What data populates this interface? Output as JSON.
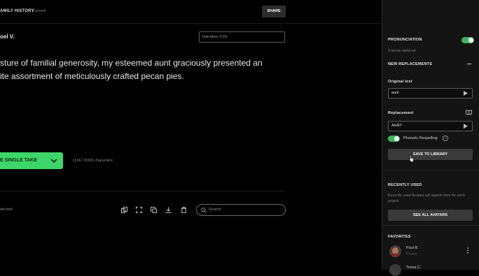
{
  "header": {
    "project_title": "AMILY HISTORY",
    "status": "Current",
    "share_label": "SHARE"
  },
  "editor": {
    "voice_name": "oel V.",
    "narration_field_value": "Narration (US)",
    "script_lines": [
      "sture of familial generosity, my esteemed aunt graciously presented an",
      "ite assortment of meticulously crafted pecan pies."
    ],
    "generate_label": "E SINGLE TAKE",
    "char_count": "(134 / 3000) characters"
  },
  "toolbar": {
    "selected_text": "elected",
    "tool_icons": [
      "copy-icon",
      "expand-icon",
      "duplicate-icon",
      "download-icon",
      "trash-icon"
    ],
    "search_placeholder": "Search"
  },
  "panel": {
    "pronunciation": {
      "title": "PRONUNCIATION",
      "enabled": true,
      "replaced_count": "0 words replaced"
    },
    "new_replacements": {
      "title": "NEW REPLACEMENTS",
      "original_label": "Original text",
      "original_value": "aunt",
      "replacement_label": "Replacement",
      "replacement_value": "AHNT",
      "phonetic_label": "Phonetic Respelling",
      "phonetic_enabled": true,
      "save_label": "SAVE TO LIBRARY"
    },
    "recently_used": {
      "title": "RECENTLY USED",
      "text": "Recently used Avatars will appear here for each project",
      "see_all_label": "SEE ALL AVATARS"
    },
    "favorites": {
      "title": "FAVORITES",
      "items": [
        {
          "name": "Paul B.",
          "sub": "Private"
        },
        {
          "name": "Tessa C."
        }
      ]
    }
  },
  "colors": {
    "accent_green": "#3ed66a",
    "toggle_green": "#3fb45e",
    "panel_bg": "#141414"
  }
}
